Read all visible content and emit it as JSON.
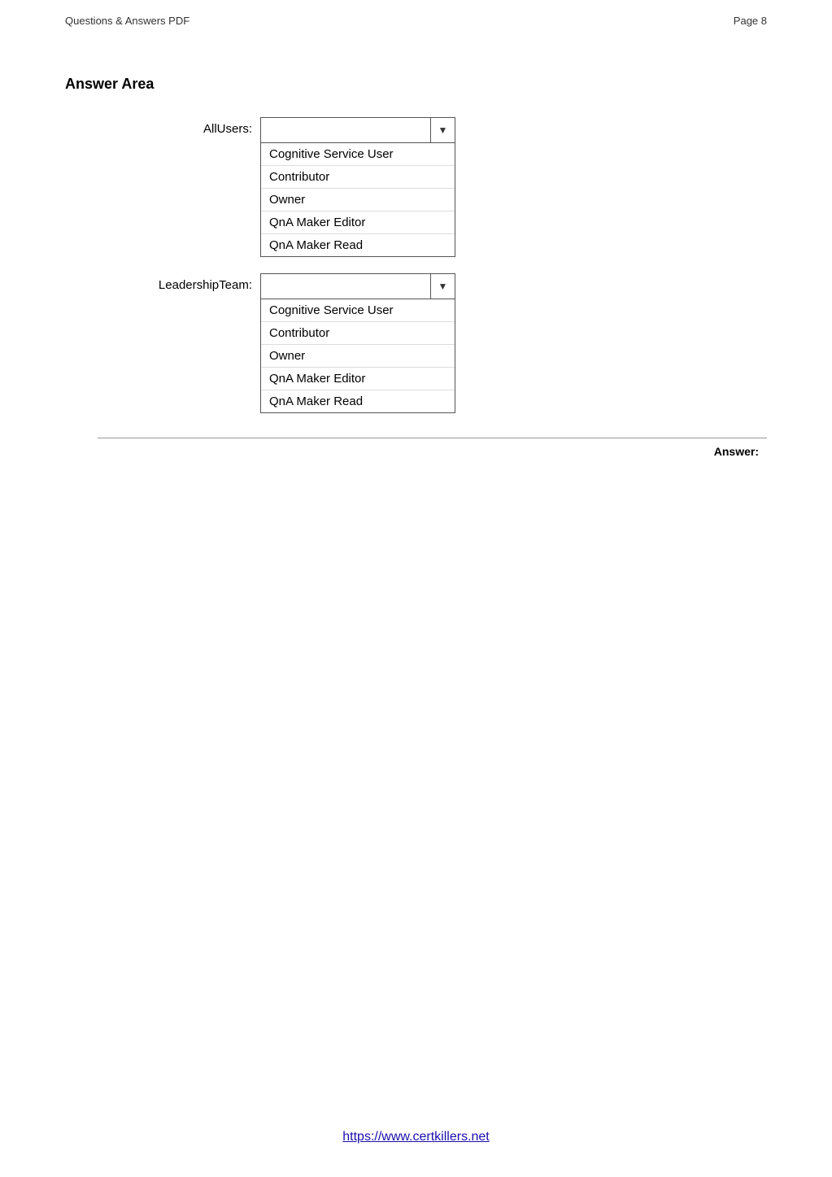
{
  "header": {
    "left_text": "Questions & Answers PDF",
    "right_text": "Page 8"
  },
  "answer_area": {
    "title": "Answer Area",
    "all_users_label": "AllUsers:",
    "leadership_team_label": "LeadershipTeam:",
    "dropdown_options": [
      "Cognitive Service User",
      "Contributor",
      "Owner",
      "QnA Maker Editor",
      "QnA Maker Read"
    ],
    "answer_label": "Answer:"
  },
  "footer": {
    "link_text": "https://www.certkillers.net"
  }
}
